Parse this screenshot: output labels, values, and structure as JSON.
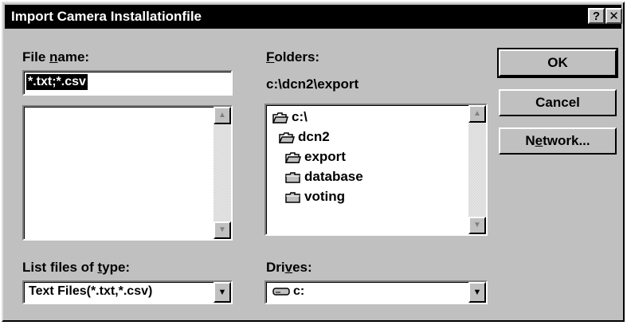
{
  "window": {
    "title": "Import Camera Installationfile",
    "help_button": "?",
    "close_button": "✕"
  },
  "file_name": {
    "label_pre": "File ",
    "label_key": "n",
    "label_post": "ame:",
    "value": "*.txt;*.csv",
    "files": []
  },
  "folders": {
    "label_key": "F",
    "label_post": "olders:",
    "current_path": "c:\\dcn2\\export",
    "items": [
      {
        "name": "c:\\",
        "icon": "open-folder-icon"
      },
      {
        "name": "dcn2",
        "icon": "open-folder-icon"
      },
      {
        "name": "export",
        "icon": "open-folder-icon"
      },
      {
        "name": "database",
        "icon": "folder-icon"
      },
      {
        "name": "voting",
        "icon": "folder-icon"
      }
    ]
  },
  "file_type": {
    "label_pre": "List files of ",
    "label_key": "t",
    "label_post": "ype:",
    "selected": "Text Files(*.txt,*.csv)"
  },
  "drives": {
    "label_pre": "Dri",
    "label_key": "v",
    "label_post": "es:",
    "selected": "c:",
    "icon": "drive-icon"
  },
  "buttons": {
    "ok": "OK",
    "cancel": "Cancel",
    "network_pre": "N",
    "network_key": "e",
    "network_post": "twork..."
  }
}
